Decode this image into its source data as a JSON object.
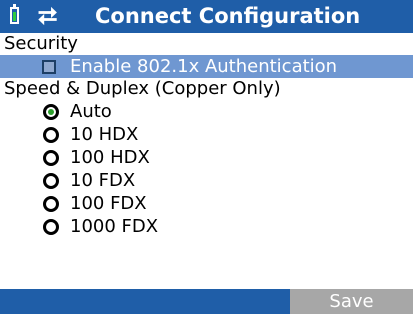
{
  "titlebar": {
    "title": "Connect Configuration",
    "battery_icon": "battery-icon",
    "usb_icon": "usb-icon",
    "usb_glyph": "⮂",
    "color": "#1f5ea8"
  },
  "security": {
    "label": "Security",
    "enable_8021x": {
      "label": "Enable 802.1x Authentication",
      "checked": false
    }
  },
  "speed_duplex": {
    "label": "Speed & Duplex (Copper Only)",
    "options": [
      {
        "label": "Auto",
        "selected": true
      },
      {
        "label": "10 HDX",
        "selected": false
      },
      {
        "label": "100 HDX",
        "selected": false
      },
      {
        "label": "10 FDX",
        "selected": false
      },
      {
        "label": "100 FDX",
        "selected": false
      },
      {
        "label": "1000 FDX",
        "selected": false
      }
    ]
  },
  "bottombar": {
    "save_label": "Save"
  },
  "colors": {
    "header": "#1f5ea8",
    "highlight": "#6f97d1",
    "save_button": "#a7a7a7",
    "radio_selected": "#2ca02c"
  }
}
